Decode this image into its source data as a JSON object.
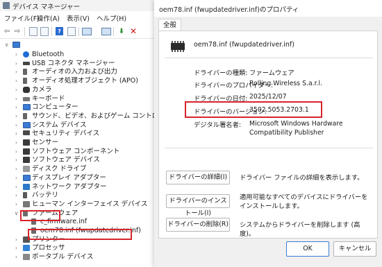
{
  "device_manager": {
    "title": "デバイス マネージャー",
    "menu": [
      "ファイル(F)",
      "操作(A)",
      "表示(V)",
      "ヘルプ(H)"
    ],
    "tree": [
      {
        "label": "Bluetooth",
        "icon": "bluetooth-icon"
      },
      {
        "label": "USB コネクタ マネージャー",
        "icon": "usb-connector-icon"
      },
      {
        "label": "オーディオの入力および出力",
        "icon": "audio-icon"
      },
      {
        "label": "オーディオ処理オブジェクト (APO)",
        "icon": "audio-processing-icon"
      },
      {
        "label": "カメラ",
        "icon": "camera-icon"
      },
      {
        "label": "キーボード",
        "icon": "keyboard-icon"
      },
      {
        "label": "コンピューター",
        "icon": "computer-icon"
      },
      {
        "label": "サウンド、ビデオ、およびゲーム コントローラー",
        "icon": "sound-icon"
      },
      {
        "label": "システム デバイス",
        "icon": "system-device-icon"
      },
      {
        "label": "セキュリティ デバイス",
        "icon": "security-device-icon"
      },
      {
        "label": "センサー",
        "icon": "sensor-icon"
      },
      {
        "label": "ソフトウェア コンポーネント",
        "icon": "software-component-icon"
      },
      {
        "label": "ソフトウェア デバイス",
        "icon": "software-device-icon"
      },
      {
        "label": "ディスク ドライブ",
        "icon": "disk-drive-icon"
      },
      {
        "label": "ディスプレイ アダプター",
        "icon": "display-adapter-icon"
      },
      {
        "label": "ネットワーク アダプター",
        "icon": "network-adapter-icon"
      },
      {
        "label": "バッテリ",
        "icon": "battery-icon"
      },
      {
        "label": "ヒューマン インターフェイス デバイス",
        "icon": "hid-icon"
      },
      {
        "label": "ファームウェア",
        "icon": "firmware-icon"
      },
      {
        "label": "c_firmware.inf",
        "icon": "firmware-chip-icon"
      },
      {
        "label": "oem78.inf (fwupdatedriver.inf)",
        "icon": "firmware-chip-icon"
      },
      {
        "label": "プリンター",
        "icon": "printer-icon"
      },
      {
        "label": "プロセッサ",
        "icon": "processor-icon"
      },
      {
        "label": "ポータブル デバイス",
        "icon": "portable-device-icon"
      }
    ]
  },
  "dialog": {
    "title": "oem78.inf (fwupdatedriver.inf)のプロパティ",
    "tab": "全般",
    "device_name": "oem78.inf (fwupdatedriver.inf)",
    "props": {
      "type_label": "ドライバーの種類:",
      "type_value": "ファームウェア",
      "provider_label": "ドライバーのプロバイダー:",
      "provider_value": "Rolling Wireless S.a.r.l.",
      "date_label": "ドライバーの日付:",
      "date_value": "2025/12/07",
      "version_label": "ドライバーのバージョン:",
      "version_value": "3502.5053.2703.1",
      "signer_label": "デジタル署名者:",
      "signer_value": "Microsoft Windows Hardware Compatibility Publisher"
    },
    "buttons": {
      "details": "ドライバーの詳細(I)",
      "details_desc": "ドライバー ファイルの詳細を表示します。",
      "install": "ドライバーのインストール(I)",
      "install_desc": "適用可能なすべてのデバイスにドライバーをインストールします。",
      "remove": "ドライバーの削除(R)",
      "remove_desc": "システムからドライバーを削除します (高度)。",
      "ok": "OK",
      "cancel": "キャンセル"
    }
  },
  "colors": {
    "highlight": "#d6242b",
    "accent": "#3a7bd5"
  }
}
